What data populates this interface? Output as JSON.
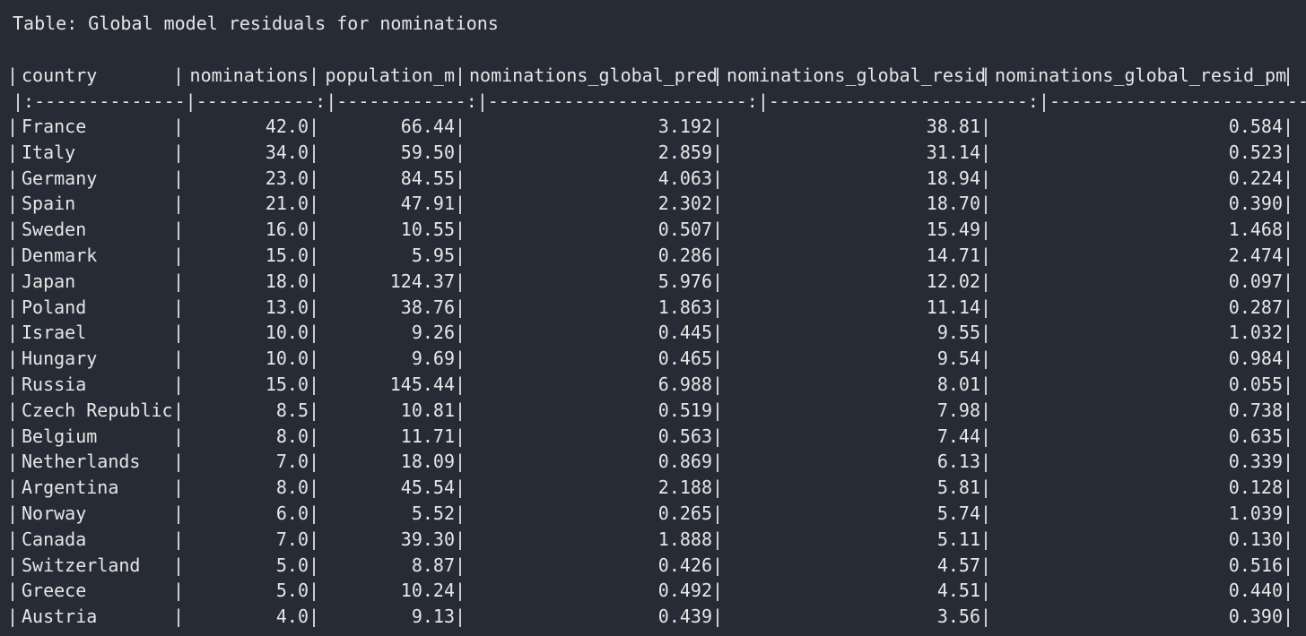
{
  "title": "Table: Global model residuals for nominations",
  "headers": [
    "country",
    "nominations",
    "population_m",
    "nominations_global_pred",
    "nominations_global_resid",
    "nominations_global_resid_pm"
  ],
  "separator": "|:--------------|-----------:|------------:|------------------------:|------------------------:|---------------------------:|",
  "rows": [
    [
      "France",
      "42.0",
      "66.44",
      "3.192",
      "38.81",
      "0.584"
    ],
    [
      "Italy",
      "34.0",
      "59.50",
      "2.859",
      "31.14",
      "0.523"
    ],
    [
      "Germany",
      "23.0",
      "84.55",
      "4.063",
      "18.94",
      "0.224"
    ],
    [
      "Spain",
      "21.0",
      "47.91",
      "2.302",
      "18.70",
      "0.390"
    ],
    [
      "Sweden",
      "16.0",
      "10.55",
      "0.507",
      "15.49",
      "1.468"
    ],
    [
      "Denmark",
      "15.0",
      "5.95",
      "0.286",
      "14.71",
      "2.474"
    ],
    [
      "Japan",
      "18.0",
      "124.37",
      "5.976",
      "12.02",
      "0.097"
    ],
    [
      "Poland",
      "13.0",
      "38.76",
      "1.863",
      "11.14",
      "0.287"
    ],
    [
      "Israel",
      "10.0",
      "9.26",
      "0.445",
      "9.55",
      "1.032"
    ],
    [
      "Hungary",
      "10.0",
      "9.69",
      "0.465",
      "9.54",
      "0.984"
    ],
    [
      "Russia",
      "15.0",
      "145.44",
      "6.988",
      "8.01",
      "0.055"
    ],
    [
      "Czech Republic",
      "8.5",
      "10.81",
      "0.519",
      "7.98",
      "0.738"
    ],
    [
      "Belgium",
      "8.0",
      "11.71",
      "0.563",
      "7.44",
      "0.635"
    ],
    [
      "Netherlands",
      "7.0",
      "18.09",
      "0.869",
      "6.13",
      "0.339"
    ],
    [
      "Argentina",
      "8.0",
      "45.54",
      "2.188",
      "5.81",
      "0.128"
    ],
    [
      "Norway",
      "6.0",
      "5.52",
      "0.265",
      "5.74",
      "1.039"
    ],
    [
      "Canada",
      "7.0",
      "39.30",
      "1.888",
      "5.11",
      "0.130"
    ],
    [
      "Switzerland",
      "5.0",
      "8.87",
      "0.426",
      "4.57",
      "0.516"
    ],
    [
      "Greece",
      "5.0",
      "10.24",
      "0.492",
      "4.51",
      "0.440"
    ],
    [
      "Austria",
      "4.0",
      "9.13",
      "0.439",
      "3.56",
      "0.390"
    ]
  ]
}
